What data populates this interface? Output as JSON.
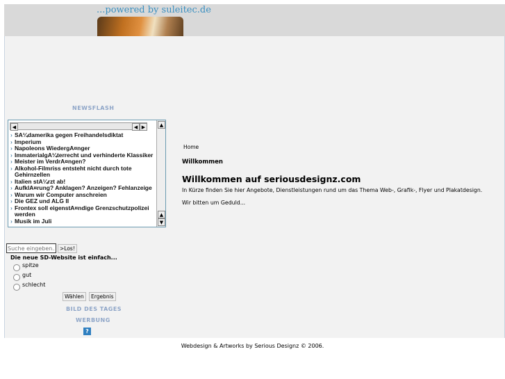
{
  "header": {
    "logo_text": "...powered by suleitec.de"
  },
  "sidebar": {
    "newsflash_title": "NEWSFLASH",
    "news": [
      "SA¼damerika gegen Freihandelsdiktat",
      "Imperium",
      "Napoleons WiedergA¤nger",
      "ImmaterialgA¼terrecht und verhinderte Klassiker",
      "Meister im VerdrA¤ngen?",
      "Alkohol-Filmriss entsteht nicht durch tote Gehirnzellen",
      "Italien stA¼rzt ab!",
      "AufklA¤rung? Anklagen? Anzeigen? Fehlanzeige",
      "Warum wir Computer anschreien",
      "Die GEZ und ALG II",
      "Frontex soll eigenstA¤ndige Grenzschutzpolizei werden",
      "Musik im Juli"
    ],
    "search_placeholder": "Suche eingeben..",
    "search_button": ">Los!",
    "poll": {
      "question": "Die neue SD-Website ist einfach...",
      "options": [
        "spitze",
        "gut",
        "schlecht"
      ],
      "vote": "Wählen",
      "results": "Ergebnis"
    },
    "bild_des_tages": "BILD DES TAGES",
    "werbung": "WERBUNG",
    "ad_icon": "?"
  },
  "content": {
    "breadcrumb": "Home",
    "section": "Willkommen",
    "heading": "Willkommen auf seriousdesignz.com",
    "p1": "In Kürze finden Sie hier Angebote, Dienstleistungen rund um das Thema Web-, Grafik-, Flyer und Plakatdesign.",
    "p2": "Wir bitten um Geduld..."
  },
  "footer": "Webdesign & Artworks by Serious Designz © 2006."
}
